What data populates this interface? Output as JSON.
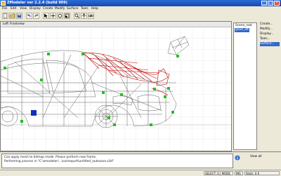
{
  "window": {
    "title": "ZModeler ver 2.2.4 (build 909)",
    "controls": [
      "_",
      "□",
      "×"
    ]
  },
  "menubar": {
    "items": [
      "File",
      "Edit",
      "View",
      "Display",
      "Create",
      "Modify",
      "Surface",
      "Tools",
      "Help"
    ]
  },
  "toolbar": {
    "buttons": [
      "new-icon",
      "open-icon",
      "save-icon",
      "undo-icon",
      "redo-icon",
      "select-icon",
      "move-icon",
      "rotate-icon",
      "scale-icon",
      "zoom-icon",
      "pan-icon",
      "orbit-icon"
    ]
  },
  "viewport": {
    "name": "Left",
    "mode": "Frontview"
  },
  "right_panel": {
    "scene_items": [
      "Scene_root",
      "gsize_aft"
    ],
    "selected_item": "gsize_aft",
    "side_buttons": [
      "Create...",
      "Modify...",
      "Display...",
      "Tools...",
      "Surface..."
    ],
    "selected_side_button": "Surface..."
  },
  "log": {
    "lines": [
      "Can apply mesh to bitmap mode. Please perform new frame.",
      "Performing process in \"C:\\zmodeler\\...\\car\\export\\untitled_autosave.z3d\""
    ],
    "view_all_label": "View all"
  },
  "statusbar": {
    "cells": [
      "SELECT: 0 | MODE",
      "INS",
      "Stats: 0 0"
    ]
  },
  "colors": {
    "titlebar": "#2a6bd6",
    "wireframe": "#606060",
    "selected_mesh": "#c00000",
    "handle": "#22c022",
    "pivot": "#1030c0"
  }
}
